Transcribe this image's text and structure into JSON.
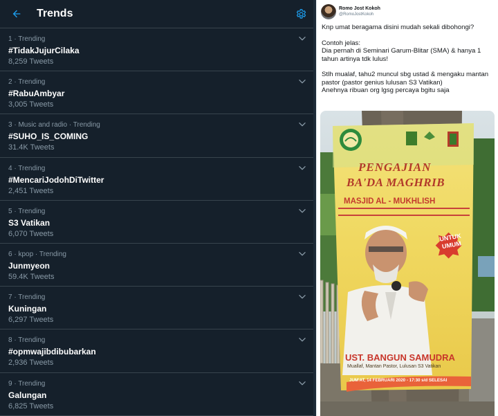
{
  "trends_panel": {
    "title": "Trends",
    "back_icon": "arrow-left-icon",
    "settings_icon": "gear-icon",
    "accent_color": "#1da1f2",
    "items": [
      {
        "meta": "1 · Trending",
        "name": "#TidakJujurCilaka",
        "count": "8,259 Tweets"
      },
      {
        "meta": "2 · Trending",
        "name": "#RabuAmbyar",
        "count": "3,005 Tweets"
      },
      {
        "meta": "3 · Music and radio · Trending",
        "name": "#SUHO_IS_COMING",
        "count": "31.4K Tweets"
      },
      {
        "meta": "4 · Trending",
        "name": "#MencariJodohDiTwitter",
        "count": "2,451 Tweets"
      },
      {
        "meta": "5 · Trending",
        "name": "S3 Vatikan",
        "count": "6,070 Tweets"
      },
      {
        "meta": "6 · kpop · Trending",
        "name": "Junmyeon",
        "count": "59.4K Tweets"
      },
      {
        "meta": "7 · Trending",
        "name": "Kuningan",
        "count": "6,297 Tweets"
      },
      {
        "meta": "8 · Trending",
        "name": "#opmwajibdibubarkan",
        "count": "2,936 Tweets"
      },
      {
        "meta": "9 · Trending",
        "name": "Galungan",
        "count": "6,825 Tweets"
      }
    ]
  },
  "tweet": {
    "display_name": "Romo Jost Kokoh",
    "handle": "@RomoJostKokoh",
    "paragraphs": [
      "Knp umat beragama disini mudah sekali dibohongi?",
      "Contoh jelas:\nDia pernah di Seminari Garum-Blitar (SMA) & hanya 1 tahun artinya tdk lulus!",
      "Stlh mualaf, tahu2 muncul sbg ustad & mengaku mantan pastor (pastor genius lulusan S3 Vatikan)\nAnehnya ribuan org lgsg percaya bgitu saja"
    ]
  },
  "banner": {
    "line1": "PENGAJIAN",
    "line2": "BA'DA MAGHRIB",
    "venue": "MASJID AL - MUKHLISH",
    "badge_line1": "UNTUK",
    "badge_line2": "UMUM",
    "speaker": "UST. BANGUN SAMUDRA",
    "speaker_desc": "Muallaf, Mantan Pastor, Lulusan S3 Vatikan",
    "schedule": "JUM'AT, 14 FEBRUARI 2020 - 17:30 s/d SELESAI"
  }
}
